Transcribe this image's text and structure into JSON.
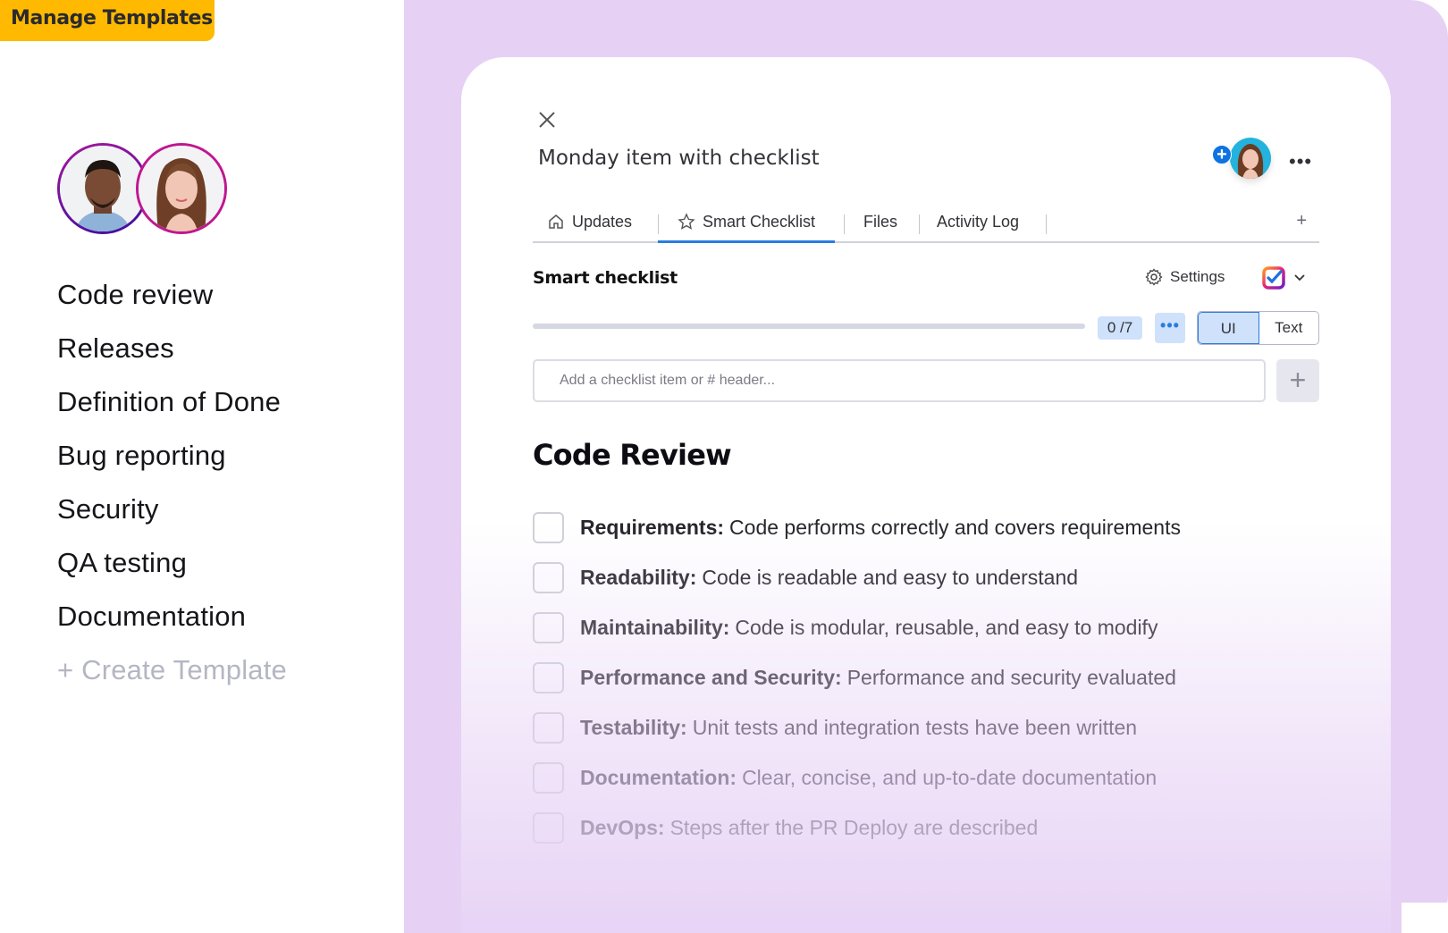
{
  "badge": {
    "label": "Manage Templates"
  },
  "templates": {
    "avatars": [
      "person-man",
      "person-woman"
    ],
    "items": [
      "Code review",
      "Releases",
      "Definition of Done",
      "Bug reporting",
      "Security",
      "QA testing",
      "Documentation"
    ],
    "create_label": "+ Create Template"
  },
  "item": {
    "title": "Monday item with checklist",
    "more_label": "•••"
  },
  "tabs": [
    {
      "label": "Updates",
      "icon": "home-icon"
    },
    {
      "label": "Smart Checklist",
      "icon": "star-icon",
      "active": true
    },
    {
      "label": "Files"
    },
    {
      "label": "Activity Log"
    }
  ],
  "tab_add": "+",
  "smart_checklist": {
    "title": "Smart checklist",
    "settings_label": "Settings",
    "progress": 0,
    "count": "0 /7",
    "dots_label": "•••",
    "view_modes": [
      "UI",
      "Text"
    ],
    "active_view": "UI",
    "input_placeholder": "Add a checklist item or # header...",
    "add_label": "+"
  },
  "section": {
    "title": "Code Review",
    "items": [
      {
        "label": "Requirements:",
        "text": "Code performs correctly and covers requirements",
        "checked": false
      },
      {
        "label": "Readability:",
        "text": "Code is readable and easy to understand",
        "checked": false
      },
      {
        "label": "Maintainability:",
        "text": "Code is modular, reusable, and easy to modify",
        "checked": false
      },
      {
        "label": "Performance and Security:",
        "text": "Performance and security evaluated",
        "checked": false
      },
      {
        "label": "Testability:",
        "text": "Unit tests and integration tests have been written",
        "checked": false
      },
      {
        "label": "Documentation:",
        "text": "Clear, concise, and up-to-date documentation",
        "checked": false
      },
      {
        "label": "DevOps:",
        "text": "Steps after the PR Deploy are described",
        "checked": false
      }
    ]
  },
  "colors": {
    "badge": "#ffb900",
    "background_panel": "#e6d1f5",
    "accent": "#2a7ce0",
    "chip": "#cfe1fb"
  }
}
